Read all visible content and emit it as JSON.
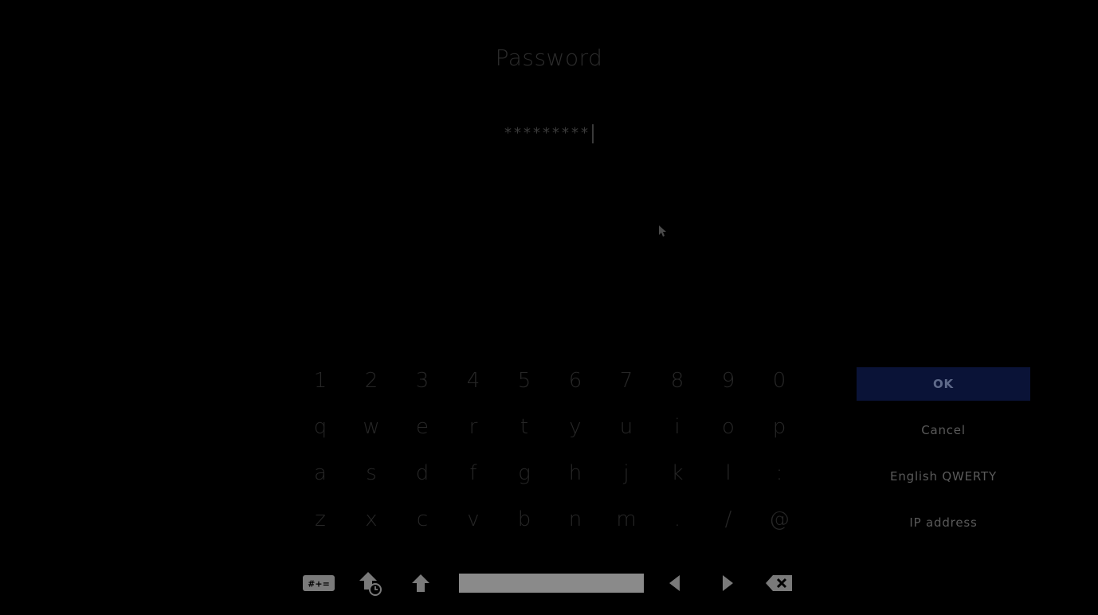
{
  "dialog": {
    "title": "Password",
    "value": "*********"
  },
  "keyboard": {
    "rows": [
      [
        "1",
        "2",
        "3",
        "4",
        "5",
        "6",
        "7",
        "8",
        "9",
        "0"
      ],
      [
        "q",
        "w",
        "e",
        "r",
        "t",
        "y",
        "u",
        "i",
        "o",
        "p"
      ],
      [
        "a",
        "s",
        "d",
        "f",
        "g",
        "h",
        "j",
        "k",
        "l",
        ":"
      ],
      [
        "z",
        "x",
        "c",
        "v",
        "b",
        "n",
        "m",
        ".",
        "/",
        "@"
      ]
    ],
    "bottom_icons": [
      "symbols-key-icon",
      "caps-lock-icon",
      "shift-icon",
      "space-bar",
      "left-arrow-icon",
      "right-arrow-icon",
      "backspace-icon"
    ],
    "symbols_label": "#+="
  },
  "side": {
    "ok": "OK",
    "cancel": "Cancel",
    "layout": "English QWERTY",
    "ip": "IP address"
  },
  "colors": {
    "background": "#000000",
    "ok_highlight": "#0a1337",
    "space_bar": "#8a8a8a"
  }
}
